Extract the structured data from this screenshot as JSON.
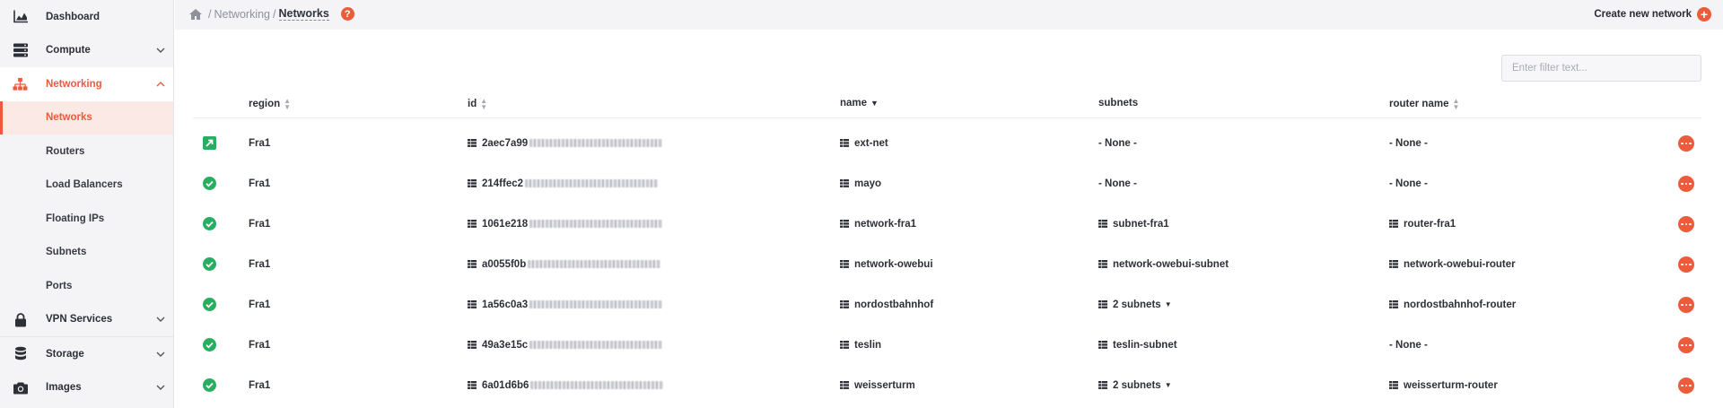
{
  "sidebar": {
    "items": [
      {
        "label": "Dashboard"
      },
      {
        "label": "Compute"
      },
      {
        "label": "Networking"
      },
      {
        "label": "VPN Services"
      },
      {
        "label": "Storage"
      },
      {
        "label": "Images"
      }
    ],
    "networking_sub": [
      {
        "label": "Networks"
      },
      {
        "label": "Routers"
      },
      {
        "label": "Load Balancers"
      },
      {
        "label": "Floating IPs"
      },
      {
        "label": "Subnets"
      },
      {
        "label": "Ports"
      }
    ]
  },
  "breadcrumb": {
    "section": "Networking",
    "current": "Networks",
    "help": "?"
  },
  "toolbar": {
    "create_label": "Create new network"
  },
  "filter": {
    "placeholder": "Enter filter text..."
  },
  "table": {
    "columns": [
      "region",
      "id",
      "name",
      "subnets",
      "router name"
    ],
    "rows": [
      {
        "status": "external",
        "region": "Fra1",
        "id": "2aec7a99",
        "name": "ext-net",
        "subnets": "- None -",
        "subnets_icon": false,
        "subnets_caret": false,
        "router": "- None -",
        "router_icon": false
      },
      {
        "status": "ok",
        "region": "Fra1",
        "id": "214ffec2",
        "name": "mayo",
        "subnets": "- None -",
        "subnets_icon": false,
        "subnets_caret": false,
        "router": "- None -",
        "router_icon": false
      },
      {
        "status": "ok",
        "region": "Fra1",
        "id": "1061e218",
        "name": "network-fra1",
        "subnets": "subnet-fra1",
        "subnets_icon": true,
        "subnets_caret": false,
        "router": "router-fra1",
        "router_icon": true
      },
      {
        "status": "ok",
        "region": "Fra1",
        "id": "a0055f0b",
        "name": "network-owebui",
        "subnets": "network-owebui-subnet",
        "subnets_icon": true,
        "subnets_caret": false,
        "router": "network-owebui-router",
        "router_icon": true
      },
      {
        "status": "ok",
        "region": "Fra1",
        "id": "1a56c0a3",
        "name": "nordostbahnhof",
        "subnets": "2 subnets",
        "subnets_icon": true,
        "subnets_caret": true,
        "router": "nordostbahnhof-router",
        "router_icon": true
      },
      {
        "status": "ok",
        "region": "Fra1",
        "id": "49a3e15c",
        "name": "teslin",
        "subnets": "teslin-subnet",
        "subnets_icon": true,
        "subnets_caret": false,
        "router": "- None -",
        "router_icon": false
      },
      {
        "status": "ok",
        "region": "Fra1",
        "id": "6a01d6b6",
        "name": "weisserturm",
        "subnets": "2 subnets",
        "subnets_icon": true,
        "subnets_caret": true,
        "router": "weisserturm-router",
        "router_icon": true
      }
    ]
  },
  "colors": {
    "accent": "#ec5b3c",
    "ok": "#27ae60"
  }
}
